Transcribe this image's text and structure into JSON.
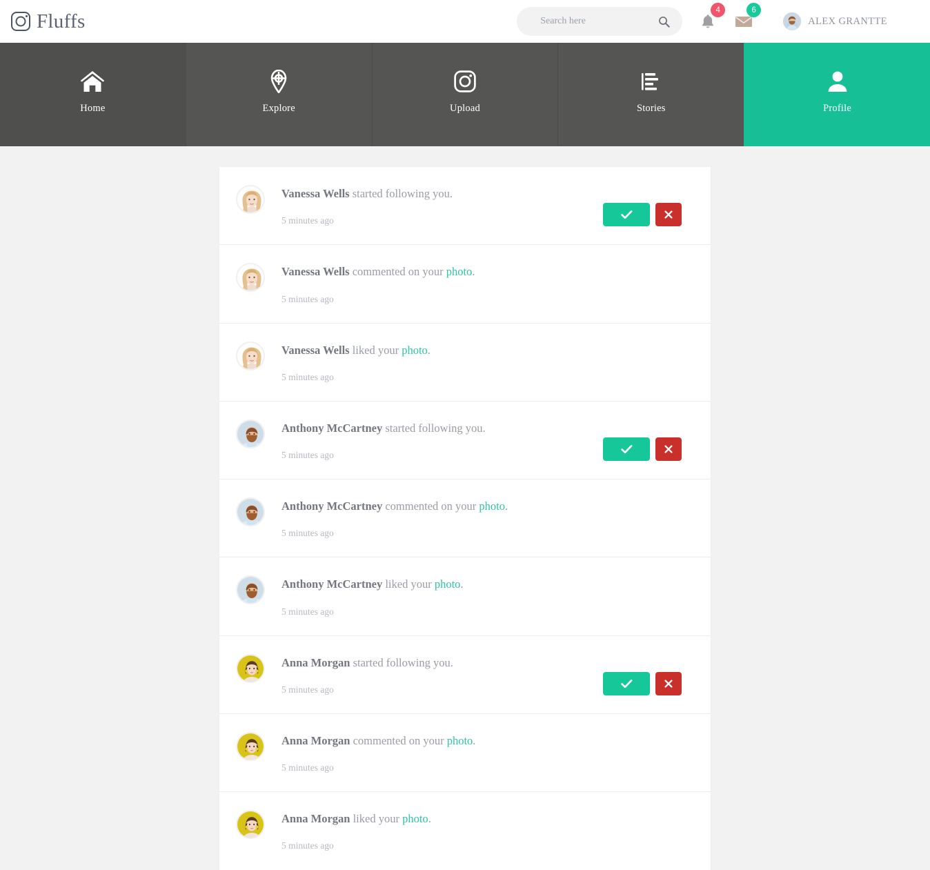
{
  "app": {
    "brand": "Fluffs",
    "brand_icon": "instagram-camera-icon",
    "accent_color": "#17bf97",
    "nav_bg_color": "#555654",
    "page_bg_color": "#f2f2f2"
  },
  "header": {
    "search": {
      "placeholder": "Search here",
      "value": "",
      "icon": "search-icon"
    },
    "notifications": {
      "icon": "bell-icon",
      "count": "4",
      "badge_color": "#f1556c"
    },
    "messages": {
      "icon": "envelope-icon",
      "count": "6",
      "badge_color": "#18c99a"
    },
    "user": {
      "name": "ALEX GRANTTE",
      "avatar": "user-avatar-bearded-man"
    }
  },
  "nav": {
    "items": [
      {
        "label": "Home",
        "icon": "home-icon",
        "active": false
      },
      {
        "label": "Explore",
        "icon": "crosshair-icon",
        "active": false
      },
      {
        "label": "Upload",
        "icon": "camera-icon",
        "active": false
      },
      {
        "label": "Stories",
        "icon": "list-icon",
        "active": false
      },
      {
        "label": "Profile",
        "icon": "person-icon",
        "active": true
      }
    ]
  },
  "notifications": {
    "accept_label": "check-icon",
    "reject_label": "times-icon",
    "items": [
      {
        "user": "Vanessa Wells",
        "action": " started following you.",
        "link": "",
        "suffix": "",
        "time": "5 minutes ago",
        "avatar": "vanessa-wells-avatar",
        "has_actions": true
      },
      {
        "user": "Vanessa Wells",
        "action": " commented on your ",
        "link": "photo",
        "suffix": ".",
        "time": "5 minutes ago",
        "avatar": "vanessa-wells-avatar",
        "has_actions": false
      },
      {
        "user": "Vanessa Wells",
        "action": " liked your ",
        "link": "photo",
        "suffix": ".",
        "time": "5 minutes ago",
        "avatar": "vanessa-wells-avatar",
        "has_actions": false
      },
      {
        "user": "Anthony McCartney",
        "action": " started following you.",
        "link": "",
        "suffix": "",
        "time": "5 minutes ago",
        "avatar": "anthony-mccartney-avatar",
        "has_actions": true
      },
      {
        "user": "Anthony McCartney",
        "action": " commented on your ",
        "link": "photo",
        "suffix": ".",
        "time": "5 minutes ago",
        "avatar": "anthony-mccartney-avatar",
        "has_actions": false
      },
      {
        "user": "Anthony McCartney",
        "action": " liked your ",
        "link": "photo",
        "suffix": ".",
        "time": "5 minutes ago",
        "avatar": "anthony-mccartney-avatar",
        "has_actions": false
      },
      {
        "user": "Anna Morgan",
        "action": " started following you.",
        "link": "",
        "suffix": "",
        "time": "5 minutes ago",
        "avatar": "anna-morgan-avatar",
        "has_actions": true
      },
      {
        "user": "Anna Morgan",
        "action": " commented on your ",
        "link": "photo",
        "suffix": ".",
        "time": "5 minutes ago",
        "avatar": "anna-morgan-avatar",
        "has_actions": false
      },
      {
        "user": "Anna Morgan",
        "action": " liked your ",
        "link": "photo",
        "suffix": ".",
        "time": "5 minutes ago",
        "avatar": "anna-morgan-avatar",
        "has_actions": false
      }
    ]
  }
}
